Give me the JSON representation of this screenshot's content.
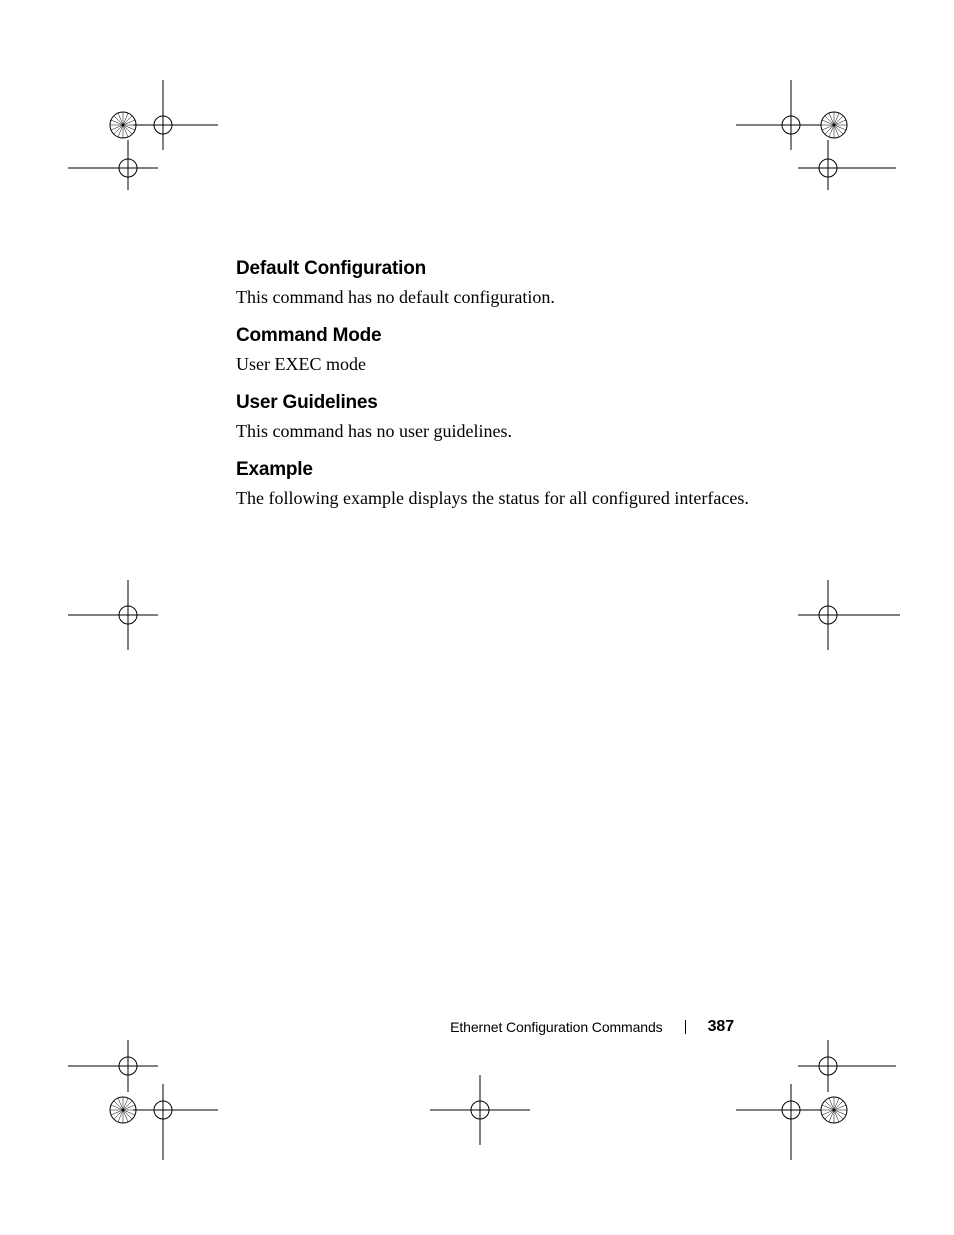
{
  "sections": {
    "defaultConfig": {
      "heading": "Default Configuration",
      "body": "This command has no default configuration."
    },
    "commandMode": {
      "heading": "Command Mode",
      "body": "User EXEC mode"
    },
    "userGuidelines": {
      "heading": "User Guidelines",
      "body": "This command has no user guidelines."
    },
    "example": {
      "heading": "Example",
      "body": "The following example displays the status for all configured interfaces."
    }
  },
  "footer": {
    "chapter": "Ethernet Configuration Commands",
    "page": "387"
  }
}
